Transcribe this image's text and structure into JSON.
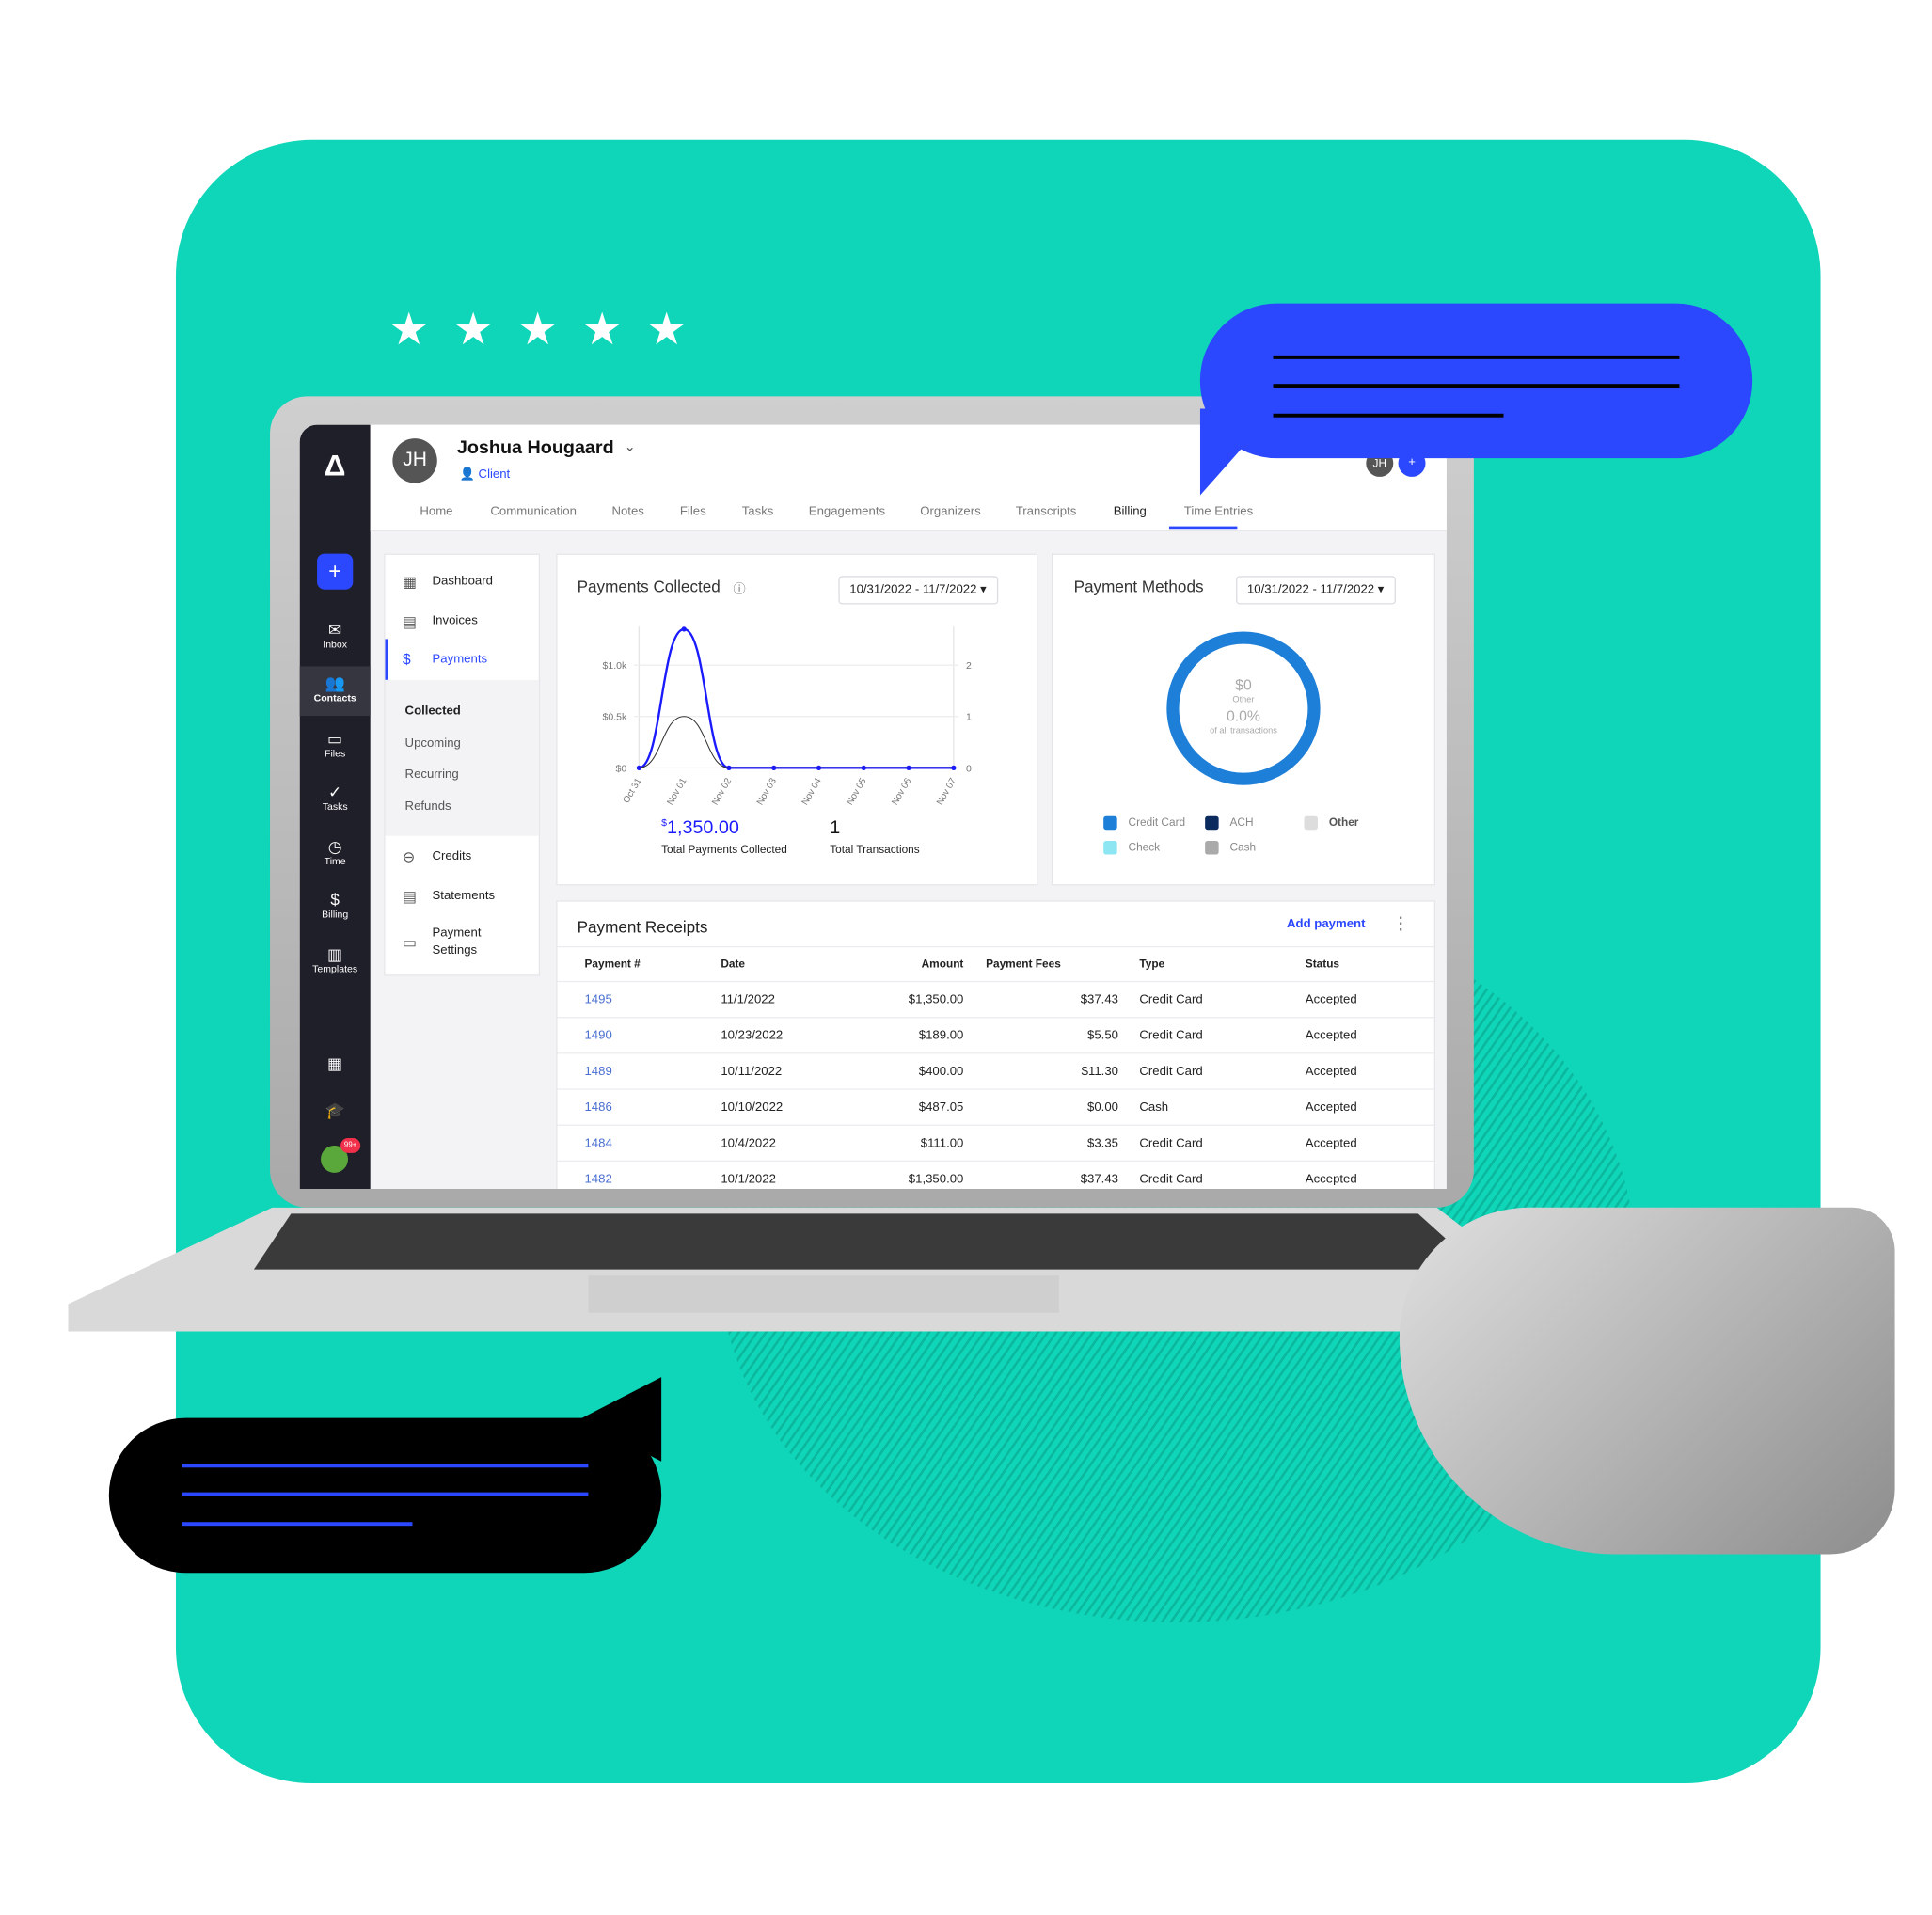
{
  "decor": {
    "teal": "#0fd6b8",
    "bubble_blue": "#2b48ff",
    "stars": 5
  },
  "sidebar": {
    "items": [
      {
        "label": "Inbox",
        "icon": "mail-icon"
      },
      {
        "label": "Contacts",
        "icon": "contacts-icon"
      },
      {
        "label": "Files",
        "icon": "folder-icon"
      },
      {
        "label": "Tasks",
        "icon": "check-circle-icon"
      },
      {
        "label": "Time",
        "icon": "clock-icon"
      },
      {
        "label": "Billing",
        "icon": "dollar-icon"
      },
      {
        "label": "Templates",
        "icon": "templates-icon"
      }
    ],
    "badge": "99+"
  },
  "header": {
    "avatar_initials": "JH",
    "name": "Joshua Hougaard",
    "role": "Client",
    "mini_avatar": "JH",
    "tabs": [
      "Home",
      "Communication",
      "Notes",
      "Files",
      "Tasks",
      "Engagements",
      "Organizers",
      "Transcripts",
      "Billing",
      "Time Entries"
    ],
    "active_tab": "Billing"
  },
  "subnav": {
    "items": [
      "Dashboard",
      "Invoices",
      "Payments"
    ],
    "active": "Payments",
    "payments_sub": [
      "Collected",
      "Upcoming",
      "Recurring",
      "Refunds"
    ],
    "items2": [
      "Credits",
      "Statements",
      "Payment Settings"
    ]
  },
  "payments_collected": {
    "title": "Payments Collected",
    "date_range": "10/31/2022 - 11/7/2022",
    "total_amount_symbol": "$",
    "total_amount": "1,350.00",
    "total_label": "Total Payments Collected",
    "transactions": "1",
    "transactions_label": "Total Transactions"
  },
  "chart_data": {
    "type": "line",
    "x": [
      "Oct 31",
      "Nov 01",
      "Nov 02",
      "Nov 03",
      "Nov 04",
      "Nov 05",
      "Nov 06",
      "Nov 07"
    ],
    "series": [
      {
        "values": [
          0,
          1350,
          0,
          0,
          0,
          0,
          0,
          0
        ],
        "axis": "left",
        "color": "#1a1aff"
      },
      {
        "values": [
          0,
          1,
          0,
          0,
          0,
          0,
          0,
          0
        ],
        "axis": "right",
        "color": "#333333"
      }
    ],
    "y_left_ticks": [
      "$0",
      "$0.5k",
      "$1.0k"
    ],
    "y_left_range": [
      0,
      1350
    ],
    "y_right_ticks": [
      "0",
      "1",
      "2"
    ],
    "y_right_range": [
      0,
      2.7
    ],
    "grid": true
  },
  "payment_methods": {
    "title": "Payment Methods",
    "date_range": "10/31/2022 - 11/7/2022",
    "center_amount": "$0",
    "center_label": "Other",
    "center_percent": "0.0%",
    "center_sub": "of all transactions",
    "ring_color": "#1e7fd8",
    "legend": [
      {
        "label": "Credit Card",
        "color": "#1e7fd8"
      },
      {
        "label": "ACH",
        "color": "#0b2b5e"
      },
      {
        "label": "Other",
        "color": "#dddddd"
      },
      {
        "label": "Check",
        "color": "#8de6f2"
      },
      {
        "label": "Cash",
        "color": "#aaaaaa"
      }
    ]
  },
  "receipts": {
    "title": "Payment Receipts",
    "add_label": "Add payment",
    "columns": [
      "Payment #",
      "Date",
      "Amount",
      "Payment Fees",
      "Type",
      "Status"
    ],
    "rows": [
      [
        "1495",
        "11/1/2022",
        "$1,350.00",
        "$37.43",
        "Credit Card",
        "Accepted"
      ],
      [
        "1490",
        "10/23/2022",
        "$189.00",
        "$5.50",
        "Credit Card",
        "Accepted"
      ],
      [
        "1489",
        "10/11/2022",
        "$400.00",
        "$11.30",
        "Credit Card",
        "Accepted"
      ],
      [
        "1486",
        "10/10/2022",
        "$487.05",
        "$0.00",
        "Cash",
        "Accepted"
      ],
      [
        "1484",
        "10/4/2022",
        "$111.00",
        "$3.35",
        "Credit Card",
        "Accepted"
      ],
      [
        "1482",
        "10/1/2022",
        "$1,350.00",
        "$37.43",
        "Credit Card",
        "Accepted"
      ]
    ]
  }
}
